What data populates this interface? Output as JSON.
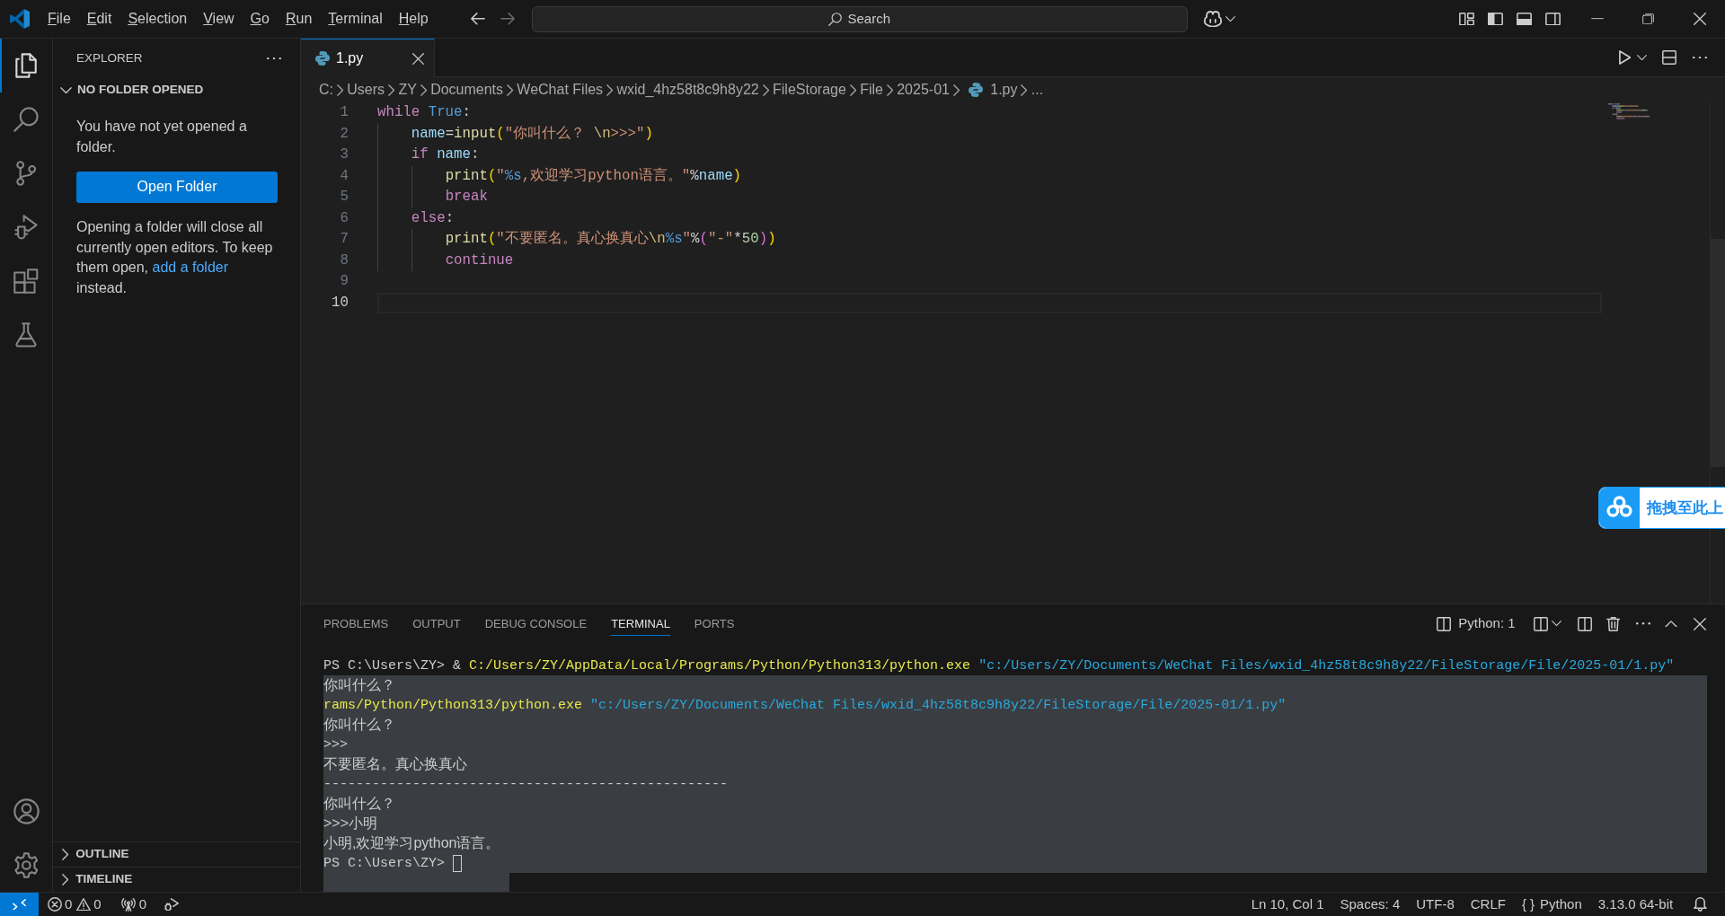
{
  "title_bar": {
    "menu": {
      "mnemonics": true,
      "items": [
        "File",
        "Edit",
        "Selection",
        "View",
        "Go",
        "Run",
        "Terminal",
        "Help"
      ]
    },
    "search": {
      "label": "Search"
    }
  },
  "activity_bar": {
    "items": [
      {
        "kind": "explorer",
        "selected": true
      },
      {
        "kind": "search",
        "selected": false
      },
      {
        "kind": "source-control",
        "selected": false
      },
      {
        "kind": "run-debug",
        "selected": false
      },
      {
        "kind": "extensions",
        "selected": false
      },
      {
        "kind": "testing",
        "selected": false
      }
    ],
    "bottom": [
      {
        "kind": "accounts"
      },
      {
        "kind": "manage"
      }
    ]
  },
  "sidebar": {
    "title": "EXPLORER",
    "sections": [
      {
        "title": "NO FOLDER OPENED",
        "expanded": true,
        "message": "You have not yet opened a folder.",
        "button": "Open Folder",
        "note": {
          "before": "Opening a folder will close all currently open editors. To keep them open, ",
          "link": "add a folder",
          "after": " instead."
        }
      },
      {
        "title": "OUTLINE",
        "expanded": false
      },
      {
        "title": "TIMELINE",
        "expanded": false
      }
    ]
  },
  "editor": {
    "tabs": [
      {
        "label": "1.py",
        "selected": true
      }
    ],
    "breadcrumb": [
      {
        "kind": "folder",
        "text": "C:"
      },
      {
        "kind": "folder",
        "text": "Users"
      },
      {
        "kind": "folder",
        "text": "ZY"
      },
      {
        "kind": "folder",
        "text": "Documents"
      },
      {
        "kind": "folder",
        "text": "WeChat Files"
      },
      {
        "kind": "folder",
        "text": "wxid_4hz58t8c9h8y22"
      },
      {
        "kind": "folder",
        "text": "FileStorage"
      },
      {
        "kind": "folder",
        "text": "File"
      },
      {
        "kind": "folder",
        "text": "2025-01"
      },
      {
        "kind": "python-file",
        "text": "1.py"
      },
      {
        "kind": "more",
        "text": "..."
      }
    ],
    "lines": [
      {
        "number": "1",
        "current": false,
        "tokens": [
          {
            "text": "while",
            "kind": "control"
          },
          {
            "text": " True",
            "kind": "constant"
          },
          {
            "text": ":",
            "kind": "plain"
          }
        ]
      },
      {
        "number": "2",
        "current": false,
        "tokens": [
          {
            "text": "    name",
            "kind": "variable"
          },
          {
            "text": "=",
            "kind": "operator"
          },
          {
            "text": "input",
            "kind": "function"
          },
          {
            "text": "(",
            "kind": "bracket"
          },
          {
            "text": "\"你叫什么？ ",
            "kind": "string"
          },
          {
            "text": "\\n",
            "kind": "escape"
          },
          {
            "text": ">>>\"",
            "kind": "string"
          },
          {
            "text": ")",
            "kind": "bracket"
          }
        ]
      },
      {
        "number": "3",
        "current": false,
        "tokens": [
          {
            "text": "    if",
            "kind": "control"
          },
          {
            "text": " name",
            "kind": "variable"
          },
          {
            "text": ":",
            "kind": "plain"
          }
        ]
      },
      {
        "number": "4",
        "current": false,
        "tokens": [
          {
            "text": "        print",
            "kind": "function"
          },
          {
            "text": "(",
            "kind": "bracket"
          },
          {
            "text": "\"",
            "kind": "string"
          },
          {
            "text": "%s",
            "kind": "format"
          },
          {
            "text": ",欢迎学习python语言。\"",
            "kind": "string"
          },
          {
            "text": "%",
            "kind": "operator"
          },
          {
            "text": "name",
            "kind": "variable"
          },
          {
            "text": ")",
            "kind": "bracket"
          }
        ]
      },
      {
        "number": "5",
        "current": false,
        "tokens": [
          {
            "text": "        break",
            "kind": "control"
          }
        ]
      },
      {
        "number": "6",
        "current": false,
        "tokens": [
          {
            "text": "    else",
            "kind": "control"
          },
          {
            "text": ":",
            "kind": "plain"
          }
        ]
      },
      {
        "number": "7",
        "current": false,
        "tokens": [
          {
            "text": "        print",
            "kind": "function"
          },
          {
            "text": "(",
            "kind": "bracket"
          },
          {
            "text": "\"不要匿名。真心换真心",
            "kind": "string"
          },
          {
            "text": "\\n",
            "kind": "escape"
          },
          {
            "text": "%s",
            "kind": "format"
          },
          {
            "text": "\"",
            "kind": "string"
          },
          {
            "text": "%",
            "kind": "operator"
          },
          {
            "text": "(",
            "kind": "bracket2"
          },
          {
            "text": "\"-\"",
            "kind": "string"
          },
          {
            "text": "*",
            "kind": "operator"
          },
          {
            "text": "50",
            "kind": "number"
          },
          {
            "text": ")",
            "kind": "bracket2"
          },
          {
            "text": ")",
            "kind": "bracket"
          }
        ]
      },
      {
        "number": "8",
        "current": false,
        "tokens": [
          {
            "text": "        continue",
            "kind": "control"
          }
        ]
      },
      {
        "number": "9",
        "current": false
      },
      {
        "number": "10",
        "current": true
      }
    ]
  },
  "panel": {
    "tabs": [
      {
        "label": "PROBLEMS",
        "selected": false
      },
      {
        "label": "OUTPUT",
        "selected": false
      },
      {
        "label": "DEBUG CONSOLE",
        "selected": false
      },
      {
        "label": "TERMINAL",
        "selected": true
      },
      {
        "label": "PORTS",
        "selected": false
      }
    ],
    "terminal_name": "Python: 1",
    "lines": [
      {
        "selected": false,
        "cursor": false,
        "segments": [
          {
            "text": "PS C:\\Users\\ZY> & ",
            "kind": "plain"
          },
          {
            "text": "C:/Users/ZY/AppData/Local/Programs/Python/Python313/python.exe",
            "kind": "command"
          },
          {
            "text": " \"c:/Users/ZY/Documents/WeChat Files/wxid_4hz58t8c9h8y22/FileStorage/File/2025-01/1.py\"",
            "kind": "string"
          }
        ]
      },
      {
        "selected": true,
        "cursor": false,
        "segments": [
          {
            "text": "你叫什么？",
            "kind": "output"
          }
        ]
      },
      {
        "selected": true,
        "cursor": false,
        "segments": [
          {
            "text": "rams/Python/Python313/python.exe",
            "kind": "command"
          },
          {
            "text": " \"c:/Users/ZY/Documents/WeChat Files/wxid_4hz58t8c9h8y22/FileStorage/File/2025-01/1.py\"",
            "kind": "string"
          }
        ]
      },
      {
        "selected": true,
        "cursor": false,
        "segments": [
          {
            "text": "你叫什么？",
            "kind": "output"
          }
        ]
      },
      {
        "selected": true,
        "cursor": false,
        "segments": [
          {
            "text": ">>>",
            "kind": "plain"
          }
        ]
      },
      {
        "selected": true,
        "cursor": false,
        "segments": [
          {
            "text": "不要匿名。真心换真心",
            "kind": "output"
          }
        ]
      },
      {
        "selected": true,
        "cursor": false,
        "segments": [
          {
            "text": "--------------------------------------------------",
            "kind": "plain"
          }
        ]
      },
      {
        "selected": true,
        "cursor": false,
        "segments": [
          {
            "text": "你叫什么？",
            "kind": "output"
          }
        ]
      },
      {
        "selected": true,
        "cursor": false,
        "segments": [
          {
            "text": ">>>小明",
            "kind": "output"
          }
        ]
      },
      {
        "selected": true,
        "cursor": false,
        "segments": [
          {
            "text": "小明,欢迎学习python语言。",
            "kind": "output"
          }
        ]
      },
      {
        "selected": true,
        "cursor": true,
        "segments": [
          {
            "text": "PS C:\\Users\\ZY> ",
            "kind": "plain"
          }
        ]
      }
    ]
  },
  "status_bar": {
    "left": [
      {
        "kind": "remote"
      },
      {
        "kind": "problems",
        "errors": "0",
        "warnings": "0"
      },
      {
        "kind": "ports",
        "text": "0"
      },
      {
        "kind": "debug"
      }
    ],
    "right": [
      {
        "kind": "position",
        "text": "Ln 10, Col 1"
      },
      {
        "kind": "indentation",
        "text": "Spaces: 4"
      },
      {
        "kind": "encoding",
        "text": "UTF-8"
      },
      {
        "kind": "eol",
        "text": "CRLF"
      },
      {
        "kind": "language",
        "glyph": "{ }",
        "text": "Python"
      },
      {
        "kind": "interpreter",
        "text": "3.13.0 64-bit"
      },
      {
        "kind": "notifications"
      }
    ]
  },
  "overlay": {
    "label": "拖拽至此上"
  }
}
